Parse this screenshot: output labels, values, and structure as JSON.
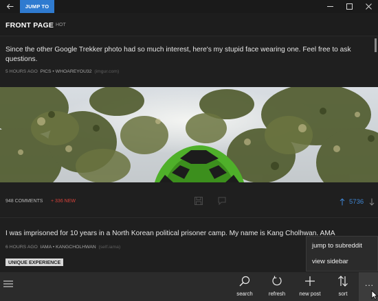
{
  "titlebar": {
    "jump_label": "JUMP TO"
  },
  "header": {
    "title": "FRONT PAGE",
    "sort": "HOT"
  },
  "posts": [
    {
      "title": "Since the other Google Trekker photo had so much interest, here's my stupid face wearing one. Feel free to ask questions.",
      "time": "5 HOURS AGO",
      "subreddit": "PICS",
      "author": "WHOAREYOU32",
      "domain": "(imgur.com)",
      "comments": "948 COMMENTS",
      "new_comments": "+ 336 NEW",
      "score": "5736"
    },
    {
      "title": "I was imprisoned for 10 years in a North Korean political prisoner camp. My name is Kang Cholhwan. AMA",
      "time": "6 HOURS AGO",
      "subreddit": "IAMA",
      "author": "KANGCHOLHWAN",
      "domain": "(self.iama)",
      "flair": "UNIQUE EXPERIENCE"
    }
  ],
  "menu": {
    "items": [
      "jump to subreddit",
      "view sidebar"
    ]
  },
  "appbar": {
    "search_label": "search",
    "refresh_label": "refresh",
    "new_post_label": "new post",
    "sort_label": "sort",
    "more_label": "..."
  },
  "colors": {
    "accent": "#2f7bd0",
    "score": "#3f86d4",
    "new_comments": "#d8423a",
    "background": "#1f1f1f",
    "appbar": "#2b2b2b"
  },
  "icons": {
    "back": "back-arrow-icon",
    "minimize": "minimize-icon",
    "maximize": "maximize-icon",
    "close": "close-icon",
    "save": "save-icon",
    "reply": "reply-icon",
    "upvote": "upvote-icon",
    "downvote": "downvote-icon",
    "menu": "hamburger-icon",
    "search": "search-icon",
    "refresh": "refresh-icon",
    "new_post": "plus-icon",
    "sort": "sort-icon"
  }
}
